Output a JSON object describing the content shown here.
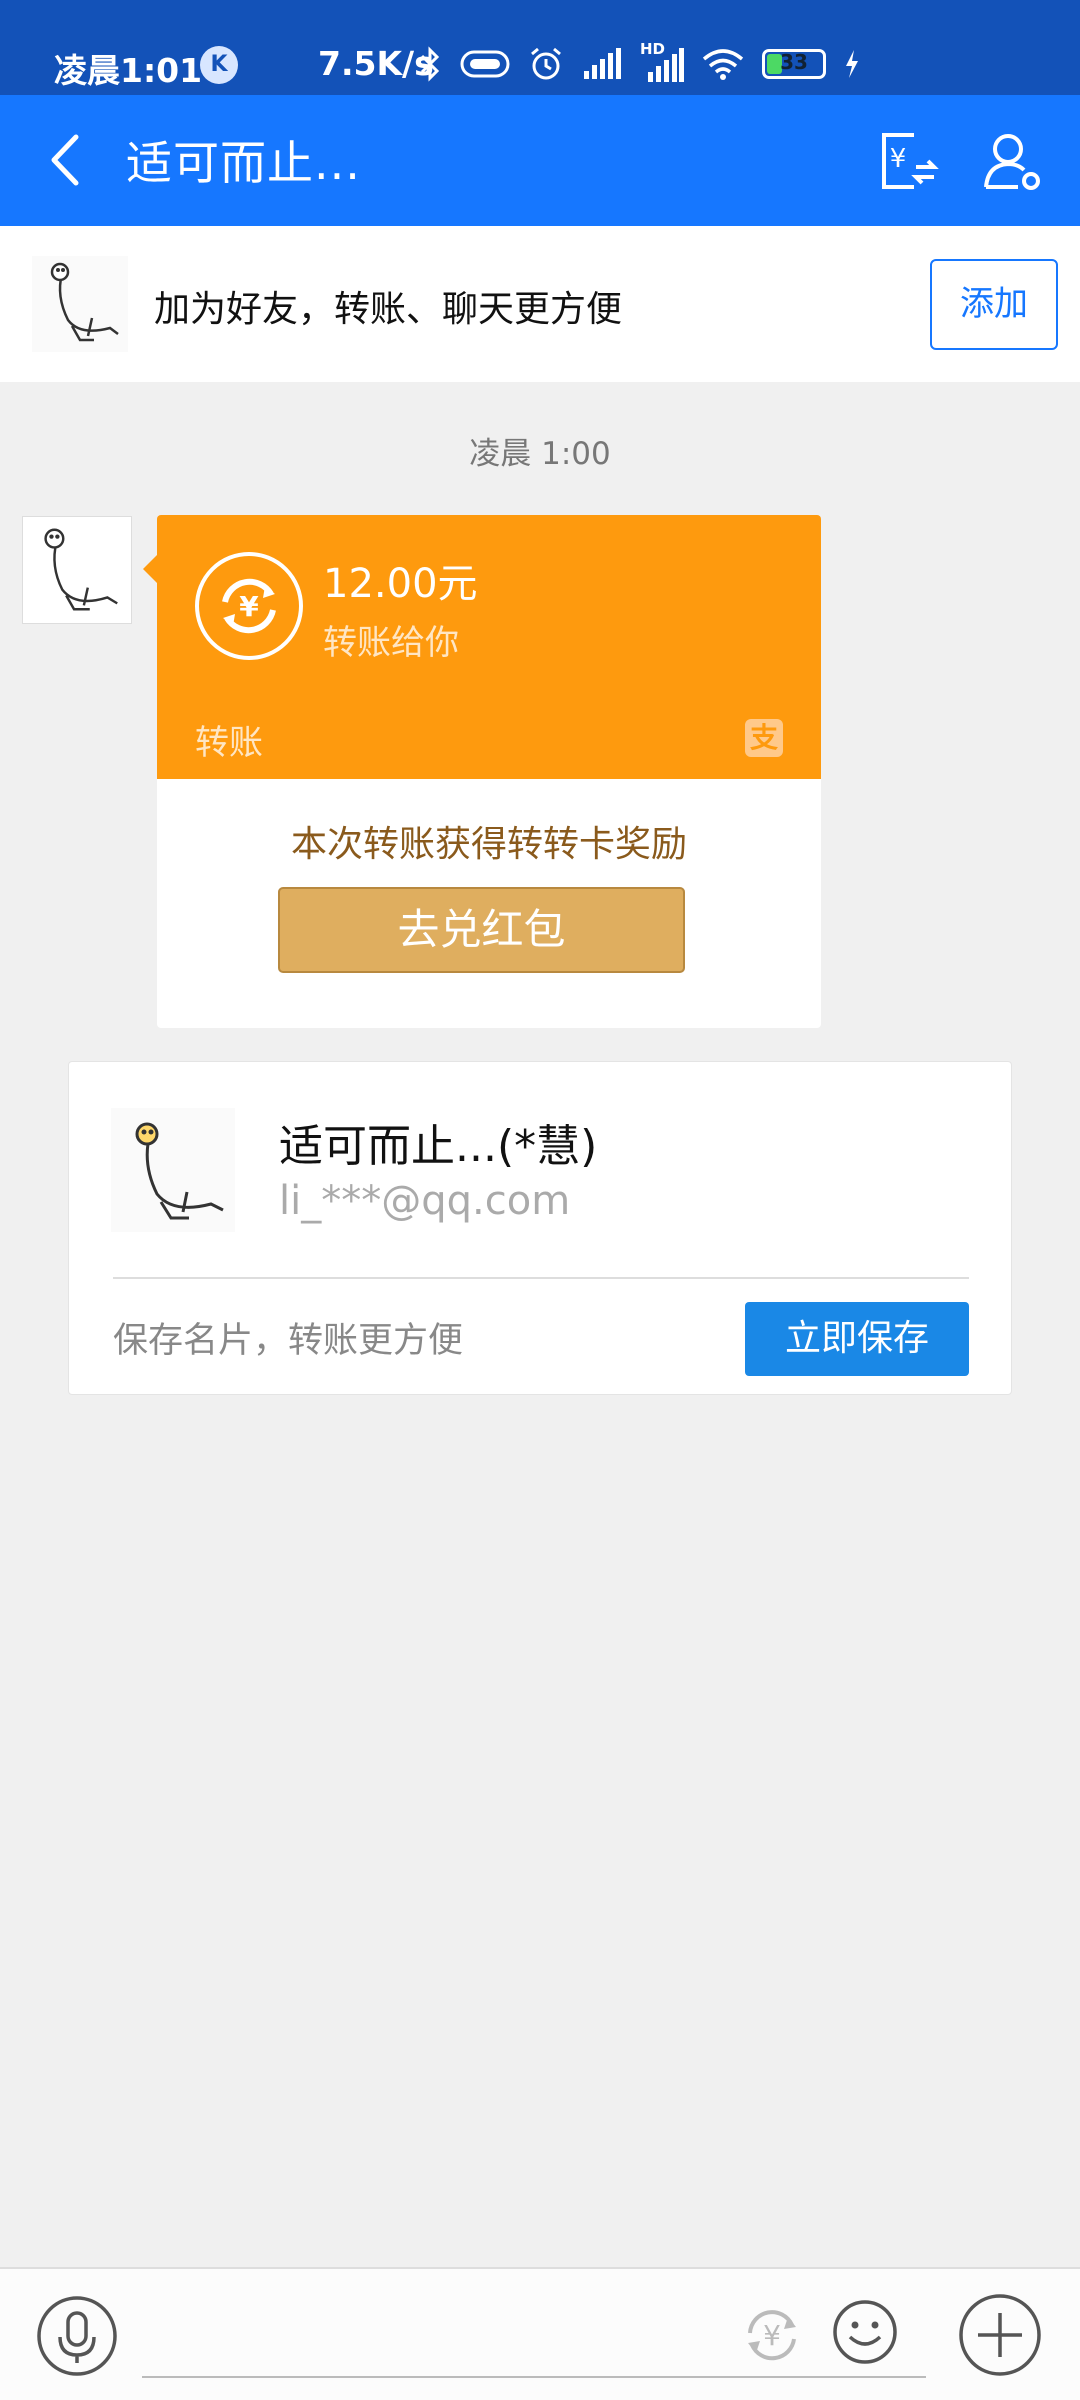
{
  "status_bar": {
    "time": "凌晨1:01",
    "k_badge": "K",
    "net_speed": "7.5K/s",
    "hd_label": "HD",
    "battery_level": "33",
    "battery_fraction": 0.33,
    "icons": [
      "k-app-icon",
      "bluetooth-icon",
      "vibrate-icon",
      "alarm-icon",
      "signal-icon",
      "signal-hd-icon",
      "wifi-icon",
      "battery-icon",
      "charging-icon"
    ]
  },
  "nav": {
    "title": "适可而止...",
    "icons": [
      "back-arrow-icon",
      "transfer-yuan-icon",
      "profile-settings-icon"
    ]
  },
  "friend_banner": {
    "text": "加为好友，转账、聊天更方便",
    "add_label": "添加"
  },
  "chat": {
    "timestamp": "凌晨 1:00",
    "transfer": {
      "amount": "12.00元",
      "desc": "转账给你",
      "type": "转账",
      "logo": "支",
      "reward_text": "本次转账获得转转卡奖励",
      "redeem_label": "去兑红包"
    },
    "contact_card": {
      "name": "适可而止...(*慧)",
      "email": "li_***@qq.com",
      "hint": "保存名片，转账更方便",
      "save_label": "立即保存"
    }
  },
  "input_bar": {
    "icons": [
      "microphone-icon",
      "yuan-transfer-icon",
      "emoji-icon",
      "plus-icon"
    ]
  },
  "colors": {
    "status_bar": "#1352b8",
    "nav_bar": "#1677ff",
    "transfer_orange": "#fe9a0e",
    "redeem_gold": "#dfae5f",
    "save_blue": "#1a88e6"
  }
}
